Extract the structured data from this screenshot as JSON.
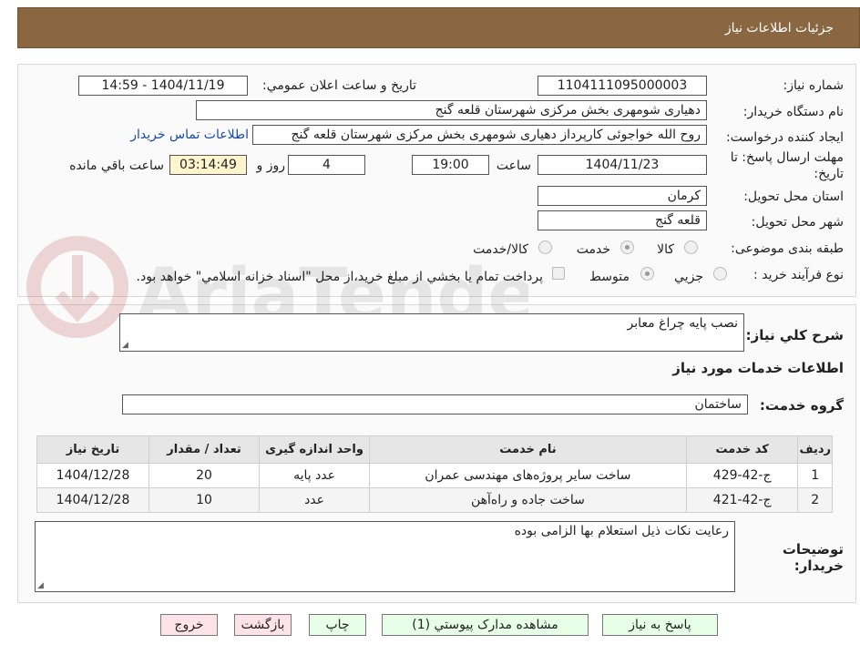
{
  "header": {
    "title": "جزئیات اطلاعات نیاز"
  },
  "fields": {
    "need_number_label": "شماره نیاز:",
    "need_number": "1104111095000003",
    "announce_label": "تاریخ و ساعت اعلان عمومي:",
    "announce_value": "1404/11/19 - 14:59",
    "buyer_org_label": "نام دستگاه خريدار:",
    "buyer_org": "دهیاری شومهری بخش مرکزی شهرستان قلعه گنج",
    "requester_label": "ايجاد کننده درخواست:",
    "requester": "روح الله خواجوئی کارپرداز دهیاری شومهری بخش مرکزی شهرستان قلعه گنج",
    "contact_link": "اطلاعات تماس خريدار",
    "deadline_label": "مهلت ارسال پاسخ: تا تاريخ:",
    "deadline_date": "1404/11/23",
    "time_label": "ساعت",
    "deadline_time": "19:00",
    "days_value": "4",
    "days_label": "روز و",
    "remaining_time": "03:14:49",
    "remaining_label": "ساعت باقي مانده",
    "province_label": "استان محل تحويل:",
    "province": "کرمان",
    "city_label": "شهر محل تحويل:",
    "city": "قلعه گنج",
    "category_label": "طبقه بندی موضوعی:",
    "category_options": [
      "کالا",
      "خدمت",
      "کالا/خدمت"
    ],
    "purchase_type_label": "نوع فرآیند خرید :",
    "purchase_options": [
      "جزيي",
      "متوسط"
    ],
    "payment_note": "پرداخت تمام يا بخشي از مبلغ خريد،از محل \"اسناد خزانه اسلامي\" خواهد بود."
  },
  "summary": {
    "label": "شرح کلي نياز:",
    "value": "نصب پایه چراغ معابر"
  },
  "services": {
    "section_title": "اطلاعات خدمات مورد نياز",
    "group_label": "گروه خدمت:",
    "group_value": "ساختمان",
    "columns": [
      "رديف",
      "کد خدمت",
      "نام خدمت",
      "واحد اندازه گيری",
      "تعداد / مقدار",
      "تاريخ نياز"
    ],
    "rows": [
      [
        "1",
        "ج-42-429",
        "ساخت سایر پروژه‌های مهندسی عمران",
        "عدد پایه",
        "20",
        "1404/12/28"
      ],
      [
        "2",
        "ج-42-421",
        "ساخت جاده و راه‌آهن",
        "عدد",
        "10",
        "1404/12/28"
      ]
    ]
  },
  "buyer_notes": {
    "label": "توضيحات خريدار:",
    "value": "رعایت نکات ذیل استعلام بها الزامی بوده"
  },
  "buttons": {
    "reply": "پاسخ به نياز",
    "attachments": "مشاهده مدارک پيوستي (1)",
    "print": "چاپ",
    "back": "بازگشت",
    "exit": "خروج"
  },
  "watermark_text": "AriaTender.neT",
  "colors": {
    "header": "#8a6741",
    "link": "#1a4aa8",
    "highlight": "#fff5cc"
  }
}
